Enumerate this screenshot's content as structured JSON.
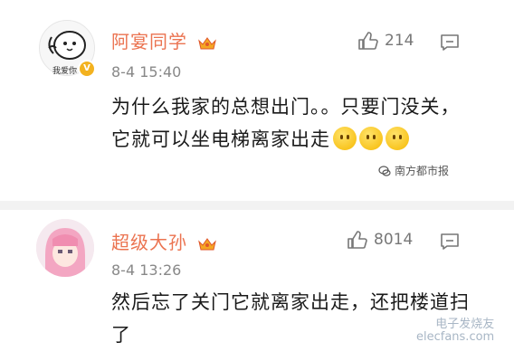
{
  "comments": [
    {
      "username": "阿宴同学",
      "avatar_caption": "我爱你",
      "timestamp": "8-4 15:40",
      "text": "为什么我家的总想出门。。只要门没关，它就可以坐电梯离家出走",
      "likes": "214",
      "emoji_count": 3
    },
    {
      "username": "超级大孙",
      "timestamp": "8-4 13:26",
      "text": "然后忘了关门它就离家出走，还把楼道扫了",
      "likes": "8014"
    }
  ],
  "watermarks": {
    "nfdb": "南方都市报",
    "elecfans_line1": "电子发烧友",
    "elecfans_line2": "elecfans.com"
  },
  "colors": {
    "username": "#eb7350",
    "meta": "#888888",
    "badge": "#f3b21f"
  }
}
